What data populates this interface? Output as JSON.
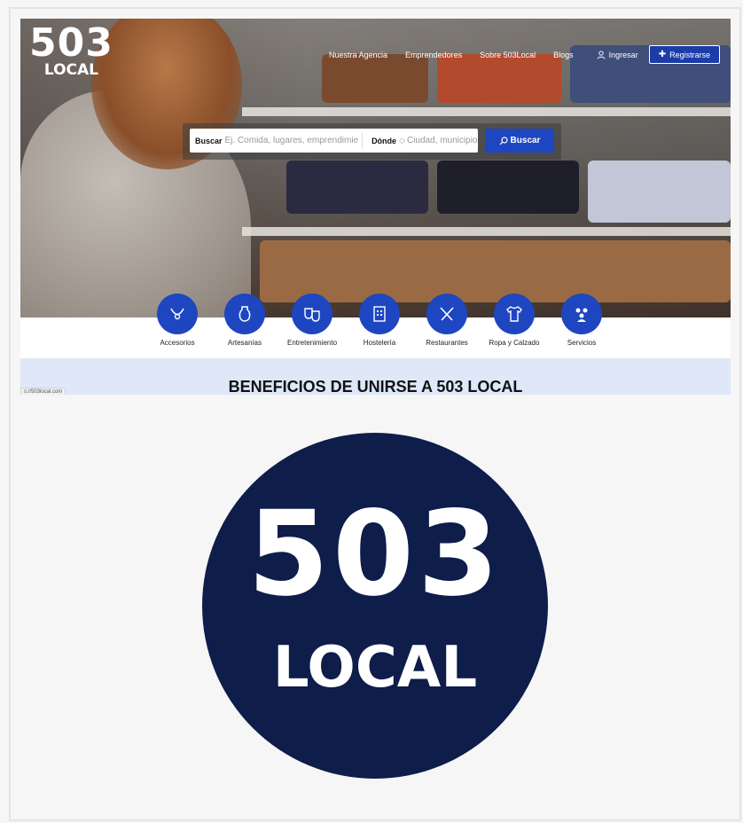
{
  "header": {
    "logo_number": "503",
    "logo_word": "LOCAL",
    "nav": [
      "Nuestra Agencia",
      "Emprendedores",
      "Sobre 503Local",
      "Blogs"
    ],
    "login_label": "Ingresar",
    "register_label": "Registrarse"
  },
  "search": {
    "what_label": "Buscar",
    "what_placeholder": "Ej. Comida, lugares, emprendimientos",
    "where_label": "Dónde",
    "where_placeholder": "Ciudad, municipio",
    "button_label": "Buscar"
  },
  "categories": [
    {
      "label": "Accesorios",
      "icon": "necklace-icon"
    },
    {
      "label": "Artesanías",
      "icon": "pottery-icon"
    },
    {
      "label": "Entretenimiento",
      "icon": "theater-masks-icon"
    },
    {
      "label": "Hostelería",
      "icon": "hotel-icon"
    },
    {
      "label": "Restaurantes",
      "icon": "utensils-icon"
    },
    {
      "label": "Ropa y Calzado",
      "icon": "clothing-icon"
    },
    {
      "label": "Servicios",
      "icon": "people-icon"
    }
  ],
  "benefits_title": "BENEFICIOS DE UNIRSE A 503 LOCAL",
  "status_url": "s://503local.com",
  "big_logo": {
    "number": "503",
    "word": "LOCAL"
  },
  "colors": {
    "brand_blue": "#1e46c1",
    "navy": "#0e1d4a",
    "benefits_bg": "#dfe8f8"
  }
}
